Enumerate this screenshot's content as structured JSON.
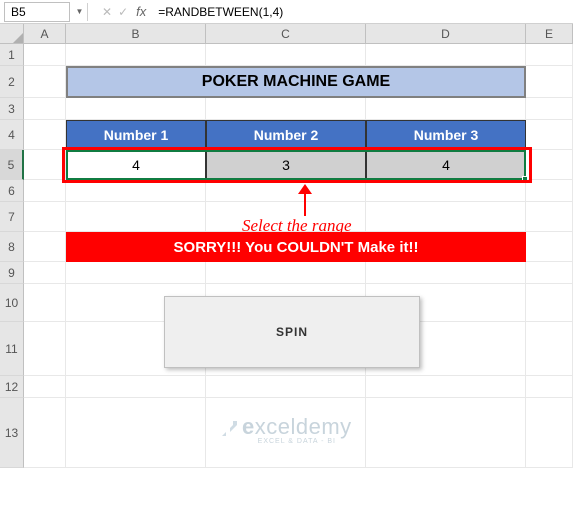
{
  "name_box": "B5",
  "formula": "=RANDBETWEEN(1,4)",
  "columns": [
    "A",
    "B",
    "C",
    "D",
    "E"
  ],
  "rows": [
    "1",
    "2",
    "3",
    "4",
    "5",
    "6",
    "7",
    "8",
    "9",
    "10",
    "11",
    "12",
    "13"
  ],
  "title": "POKER MACHINE GAME",
  "table": {
    "headers": [
      "Number 1",
      "Number 2",
      "Number 3"
    ],
    "values": [
      "4",
      "3",
      "4"
    ]
  },
  "result_msg": "SORRY!!! You COULDN'T Make it!!",
  "annotation": "Select the range",
  "spin_label": "SPIN",
  "watermark": {
    "main_prefix": "e",
    "main_rest": "xceldemy",
    "sub": "EXCEL & DATA - BI"
  },
  "chart_data": {
    "type": "table",
    "title": "POKER MACHINE GAME",
    "columns": [
      "Number 1",
      "Number 2",
      "Number 3"
    ],
    "rows": [
      [
        4,
        3,
        4
      ]
    ],
    "result": "SORRY!!! You COULDN'T Make it!!"
  }
}
